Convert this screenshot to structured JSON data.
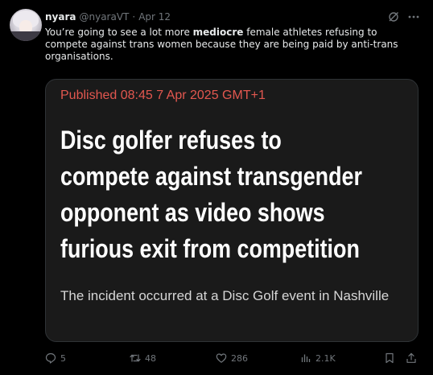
{
  "post": {
    "author_name": "nyara",
    "author_handle": "@nyaraVT",
    "separator": "·",
    "date": "Apr 12",
    "text_before": "You’re going to see a lot more ",
    "text_bold": "mediocre",
    "text_after": " female athletes refusing to compete against trans women because they are being paid by anti-trans organisations."
  },
  "card": {
    "published": "Published 08:45 7 Apr 2025 GMT+1",
    "headline_lines": [
      "Disc golfer refuses to",
      "compete against transgender",
      "opponent as video shows",
      "furious exit from competition"
    ],
    "standfirst": "The incident occurred at a Disc Golf event in Nashville"
  },
  "actions": {
    "replies": "5",
    "reposts": "48",
    "likes": "286",
    "views": "2.1K"
  },
  "icons": {
    "reply": "reply-icon",
    "repost": "repost-icon",
    "like": "heart-icon",
    "views": "views-icon",
    "bookmark": "bookmark-icon",
    "share": "share-icon",
    "grok": "grok-icon",
    "more": "more-icon"
  },
  "colors": {
    "background": "#000000",
    "card_background": "#1a1a1a",
    "published_red": "#e2574f",
    "muted": "#71767b",
    "text": "#e7e9ea"
  }
}
